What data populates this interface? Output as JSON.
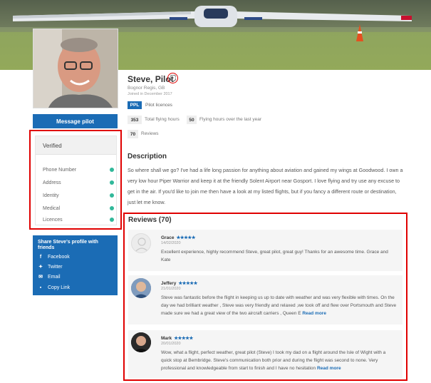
{
  "profile": {
    "name": "Steve, Pilot",
    "location": "Bognor Regis, GB",
    "joined": "Joined in December 2017",
    "licence_badge": "PPL",
    "licence_label": "Pilot licences",
    "total_hours": "353",
    "total_hours_label": "Total flying hours",
    "year_hours": "50",
    "year_hours_label": "Flying hours over the last year",
    "reviews_count": "70",
    "reviews_label": "Reviews"
  },
  "actions": {
    "message_button": "Message pilot"
  },
  "verified": {
    "title": "Verified",
    "items": [
      "Phone Number",
      "Address",
      "Identity",
      "Medical",
      "Licences"
    ],
    "status_color": "#31b89a"
  },
  "share": {
    "title": "Share Steve's profile with friends",
    "items": [
      {
        "label": "Facebook",
        "icon": "facebook-icon"
      },
      {
        "label": "Twitter",
        "icon": "twitter-icon"
      },
      {
        "label": "Email",
        "icon": "email-icon"
      },
      {
        "label": "Copy Link",
        "icon": "copy-link-icon"
      }
    ]
  },
  "description": {
    "title": "Description",
    "body": "So where shall we go? I've had a life long passion for anything about aviation and gained my wings at Goodwood. I own a very low hour Piper Warrior and keep it at the friendly Solent Airport near Gosport. I love flying and try use any excuse to get in the air. If you'd like to join me then have a look at my listed flights, but if you fancy a different route or destination, just let me know."
  },
  "reviews": {
    "title": "Reviews (70)",
    "read_more": "Read more",
    "stars": "★★★★★",
    "items": [
      {
        "name": "Grace",
        "date": "14/02/2020",
        "text": "Excellent experience, highly recommend Steve, great pilot, great guy! Thanks for an awesome time. Grace and Kate"
      },
      {
        "name": "Jeffery",
        "date": "21/01/2020",
        "text": "Steve was fantastic before the flight in keeping us up to date with weather and was very flexible with times. On the day we had brilliant weather , Steve was very friendly and relaxed ,we took off and flew over Portsmouth and Steve made sure we had a great view of the two aircraft carriers , Queen E"
      },
      {
        "name": "Mark",
        "date": "20/01/2020",
        "text": "Wow, what a flight, perfect weather, great pilot (Steve) I took my dad on a flight around the Isle of Wight with a quick stop at Bembridge. Steve's communication both prior and during the flight was second to none. Very professional and knowledgeable from start to finish and I have no hesitation"
      }
    ]
  },
  "colors": {
    "accent": "#1b6cb5",
    "highlight_border": "#e00000"
  }
}
